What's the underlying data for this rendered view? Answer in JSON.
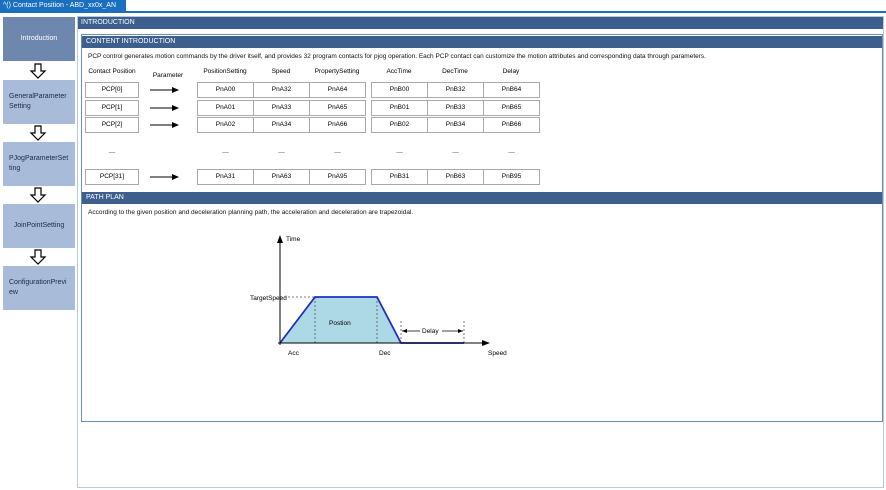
{
  "window": {
    "title": "Contact Position - ABD_xx0x_AN"
  },
  "sidebar": {
    "items": [
      {
        "label": "Introduction"
      },
      {
        "label": "GeneralParameter Setting"
      },
      {
        "label": "PJogParameterSetting"
      },
      {
        "label": "JoinPointSetting"
      },
      {
        "label": "ConfigurationPreview"
      }
    ]
  },
  "main": {
    "header": "INTRODUCTION"
  },
  "content": {
    "header": "CONTENT INTRODUCTION",
    "description": "PCP control generates motion commands by the driver itself, and provides 32 program contacts for pjog operation. Each PCP contact can customize the motion attributes and corresponding data through parameters.",
    "columns": [
      "Contact Position",
      "Parameter",
      "PositionSetting",
      "Speed",
      "PropertySetting",
      "AccTime",
      "DecTime",
      "Delay"
    ],
    "rows": [
      [
        "PCP[0]",
        "PnA00",
        "PnA32",
        "PnA64",
        "PnB00",
        "PnB32",
        "PnB64"
      ],
      [
        "PCP[1]",
        "PnA01",
        "PnA33",
        "PnA65",
        "PnB01",
        "PnB33",
        "PnB65"
      ],
      [
        "PCP[2]",
        "PnA02",
        "PnA34",
        "PnA66",
        "PnB02",
        "PnB34",
        "PnB66"
      ],
      [
        "PCP[31]",
        "PnA31",
        "PnA63",
        "PnA95",
        "PnB31",
        "PnB63",
        "PnB95"
      ]
    ],
    "ellipsis": "—"
  },
  "path_plan": {
    "header": "PATH PLAN",
    "description": "According to the given position and deceleration planning path, the acceleration and deceleration are trapezoidal.",
    "diagram": {
      "y_axis_label": "Time",
      "x_axis_label": "Speed",
      "target_speed_label": "TargetSpeed",
      "position_label": "Postion",
      "acc_label": "Acc",
      "dec_label": "Dec",
      "delay_label": "Delay",
      "fill_color": "#add8e6",
      "line_color": "#1f2fbf"
    }
  }
}
